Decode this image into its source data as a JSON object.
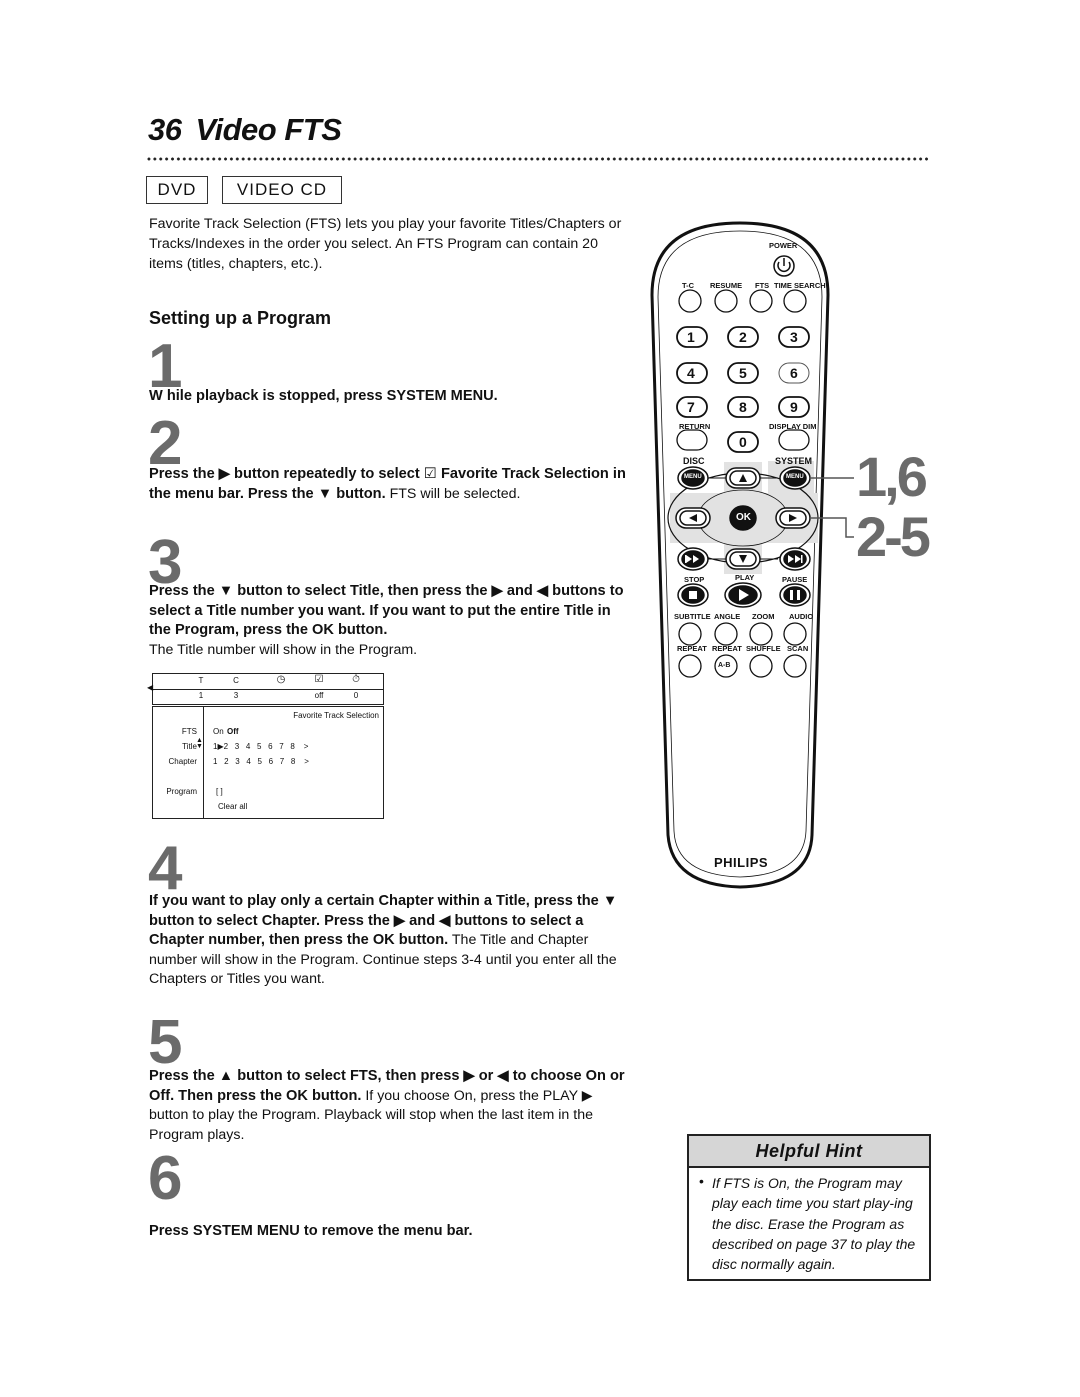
{
  "header": {
    "page_number": "36",
    "title": "Video FTS"
  },
  "disc_badges": [
    "DVD",
    "VIDEO CD"
  ],
  "intro": "Favorite Track Selection (FTS) lets you play your favorite Titles/Chapters or Tracks/Indexes in the order you select. An FTS Program can contain 20 items (titles, chapters, etc.).",
  "section_title": "Setting up a Program",
  "steps": [
    {
      "number": "1",
      "bold": "W hile playback is stopped, press SYSTEM MENU.",
      "normal": ""
    },
    {
      "number": "2",
      "bold_a": "Press the ▶ button repeatedly to select ",
      "checkbox_icon": "☑",
      "bold_b": " Favorite Track Selection in the menu bar. Press the ▼ button.",
      "normal": " FTS will be selected."
    },
    {
      "number": "3",
      "bold": "Press the ▼ button to select Title, then press the ▶ and ◀ buttons to select a Title number you want. If you want to put the entire Title in the Program, press the OK button.",
      "normal": "The Title number will show in the Program."
    },
    {
      "number": "4",
      "bold": "If you want to play only a certain Chapter within a Title, press the ▼ button to select Chapter. Press the ▶ and ◀ buttons to select a Chapter number, then press the OK button.",
      "normal": " The Title and Chapter number will show in the Program. Continue steps 3-4 until you enter all the Chapters or Titles you want."
    },
    {
      "number": "5",
      "bold": "Press the ▲ button to select FTS, then press ▶ or ◀ to choose On or Off. Then press the OK button.",
      "normal": " If you choose On, press the PLAY ▶ button to play the Program. Playback will stop when the last item in the Program plays."
    },
    {
      "number": "6",
      "bold": "Press SYSTEM MENU to remove the menu bar.",
      "normal": ""
    }
  ],
  "osd": {
    "bar_headers": [
      "T",
      "C",
      "audio-clock-icon",
      "checkbox-icon",
      "timer-icon"
    ],
    "bar_header_text": {
      "t": "T",
      "c": "C"
    },
    "bar_values": {
      "t": "1",
      "c": "3",
      "fts": "off",
      "timer": "0"
    },
    "panel_title": "Favorite Track Selection",
    "labels": {
      "fts": "FTS",
      "title": "Title",
      "chapter": "Chapter",
      "program": "Program"
    },
    "fts_on": "On",
    "fts_off": "Off",
    "title_numbers": [
      "1",
      "2",
      "3",
      "4",
      "5",
      "6",
      "7",
      "8",
      ">"
    ],
    "chapter_numbers": [
      "1",
      "2",
      "3",
      "4",
      "5",
      "6",
      "7",
      "8",
      ">"
    ],
    "program_value": "[ ]",
    "clear_all": "Clear all"
  },
  "remote": {
    "brand": "PHILIPS",
    "power_label": "POWER",
    "top_row_labels": [
      "T-C",
      "RESUME",
      "FTS",
      "TIME SEARCH"
    ],
    "digits": [
      "1",
      "2",
      "3",
      "4",
      "5",
      "6",
      "7",
      "8",
      "9",
      "0"
    ],
    "return_label": "RETURN",
    "display_dim_label": "DISPLAY DIM",
    "disc_label": "DISC",
    "system_label": "SYSTEM",
    "menu_label": "MENU",
    "ok_label": "OK",
    "stop_label": "STOP",
    "play_label": "PLAY",
    "pause_label": "PAUSE",
    "row_a_labels": [
      "SUBTITLE",
      "ANGLE",
      "ZOOM",
      "AUDIO"
    ],
    "row_b_labels": [
      "REPEAT",
      "REPEAT",
      "SHUFFLE",
      "SCAN"
    ],
    "ab_label": "A-B",
    "callout_1": "1,6",
    "callout_2": "2-5"
  },
  "hint": {
    "title": "Helpful Hint",
    "bullet": "•",
    "text": "If FTS is On, the Program may play each time you start play-ing the disc. Erase the Program as described on page 37 to play the disc normally again."
  }
}
